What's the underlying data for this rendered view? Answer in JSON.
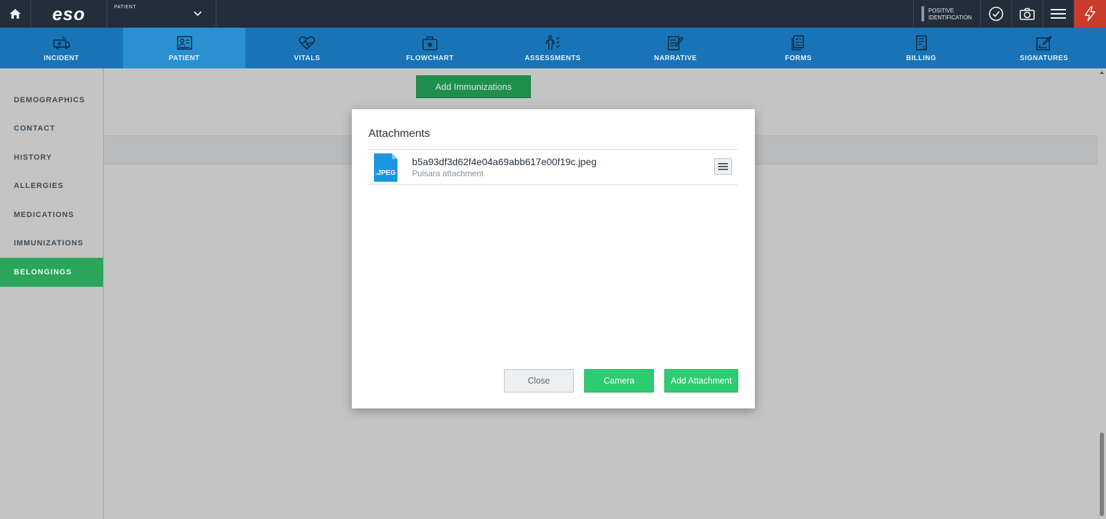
{
  "topbar": {
    "logo": "eso",
    "patient_label": "PATIENT",
    "positive_id_line1": "POSITIVE",
    "positive_id_line2": "IDENTIFICATION"
  },
  "nav": {
    "items": [
      {
        "label": "INCIDENT",
        "icon": "ambulance-icon"
      },
      {
        "label": "PATIENT",
        "icon": "patient-card-icon"
      },
      {
        "label": "VITALS",
        "icon": "heartbeat-icon"
      },
      {
        "label": "FLOWCHART",
        "icon": "medical-bag-icon"
      },
      {
        "label": "ASSESSMENTS",
        "icon": "body-checklist-icon"
      },
      {
        "label": "NARRATIVE",
        "icon": "notepad-pen-icon"
      },
      {
        "label": "FORMS",
        "icon": "forms-checklist-icon"
      },
      {
        "label": "BILLING",
        "icon": "billing-doc-icon"
      },
      {
        "label": "SIGNATURES",
        "icon": "signature-pen-icon"
      }
    ],
    "active": "PATIENT"
  },
  "sidebar": {
    "items": [
      {
        "label": "DEMOGRAPHICS"
      },
      {
        "label": "CONTACT"
      },
      {
        "label": "HISTORY"
      },
      {
        "label": "ALLERGIES"
      },
      {
        "label": "MEDICATIONS"
      },
      {
        "label": "IMMUNIZATIONS"
      },
      {
        "label": "BELONGINGS"
      }
    ],
    "active": "BELONGINGS"
  },
  "main": {
    "add_immunizations_label": "Add Immunizations"
  },
  "modal": {
    "title": "Attachments",
    "attachments": [
      {
        "file_type": ".JPEG",
        "file_name": "b5a93df3d62f4e04a69abb617e00f19c.jpeg",
        "subtitle": "Pulsara attachment"
      }
    ],
    "close_label": "Close",
    "camera_label": "Camera",
    "add_attachment_label": "Add Attachment"
  },
  "colors": {
    "topbar": "#232e3b",
    "navbar": "#1874b6",
    "nav_active": "#2a90d1",
    "sidebar_active": "#2aa55b",
    "primary_button": "#2ecc71",
    "alert": "#c93b2b"
  }
}
